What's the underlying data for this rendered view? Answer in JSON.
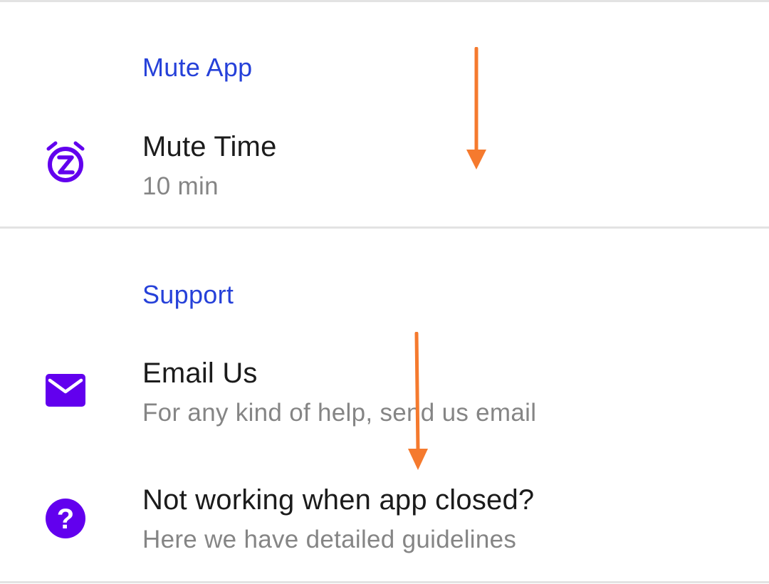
{
  "sections": [
    {
      "header": "Mute App",
      "items": [
        {
          "title": "Mute Time",
          "subtitle": "10 min",
          "icon": "alarm-snooze-icon"
        }
      ]
    },
    {
      "header": "Support",
      "items": [
        {
          "title": "Email Us",
          "subtitle": "For any kind of help, send us email",
          "icon": "mail-icon"
        },
        {
          "title": "Not working when app closed?",
          "subtitle": "Here we have detailed guidelines",
          "icon": "help-circle-icon"
        }
      ]
    }
  ],
  "colors": {
    "accent": "#6200ee",
    "header": "#2641d9",
    "title": "#1b1b1b",
    "subtitle": "#858585",
    "annotation_arrow": "#f57a2e",
    "divider": "#e3e3e3"
  }
}
